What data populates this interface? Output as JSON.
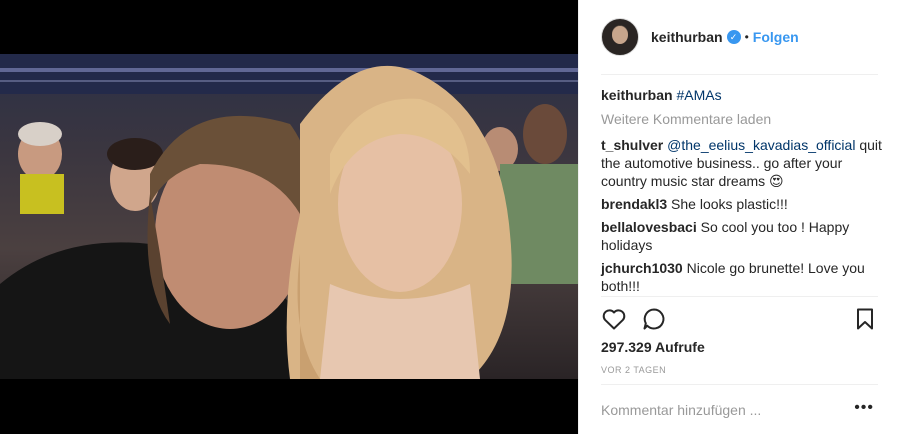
{
  "header": {
    "username": "keithurban",
    "follow_label": "Folgen",
    "separator": "•"
  },
  "caption": {
    "username": "keithurban",
    "text": "#AMAs"
  },
  "load_more_label": "Weitere Kommentare laden",
  "comments": [
    {
      "user": "t_shulver",
      "mention": "@the_eelius_kavadias_official",
      "text": " quit the automotive business.. go after your country music star dreams 😍"
    },
    {
      "user": "brendakl3",
      "text": " She looks plastic!!!"
    },
    {
      "user": "bellalovesbaci",
      "text": " So cool you too ! Happy holidays"
    },
    {
      "user": "jchurch1030",
      "text": " Nicole go brunette! Love you both!!!"
    }
  ],
  "stats": {
    "views": "297.329 Aufrufe",
    "time": "VOR 2 TAGEN"
  },
  "comment_input": {
    "placeholder": "Kommentar hinzufügen ..."
  },
  "more_options": "•••",
  "icons": {
    "like": "heart-icon",
    "comment": "comment-icon",
    "save": "bookmark-icon",
    "verified": "verified-badge-icon"
  },
  "colors": {
    "link_blue": "#3897f0",
    "hashtag": "#003569",
    "muted": "#999999"
  }
}
